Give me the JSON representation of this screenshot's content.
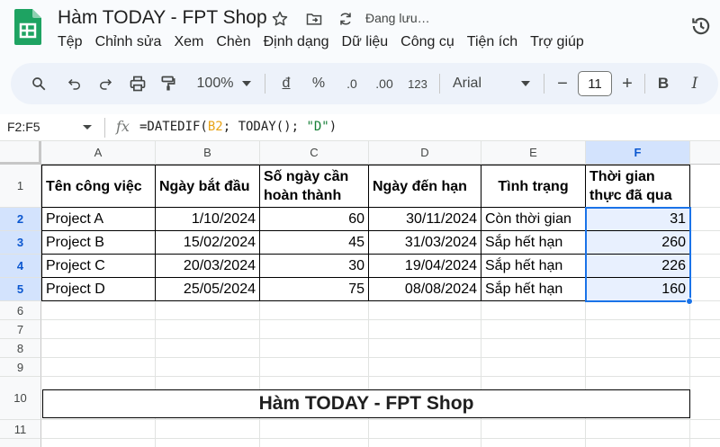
{
  "window": {
    "title": "Hàm TODAY - FPT Shop",
    "save_status": "Đang lưu…"
  },
  "menu": [
    "Tệp",
    "Chỉnh sửa",
    "Xem",
    "Chèn",
    "Định dạng",
    "Dữ liệu",
    "Công cụ",
    "Tiện ích",
    "Trợ giúp"
  ],
  "toolbar": {
    "zoom": "100%",
    "currency": "đ",
    "percent": "%",
    "decrease_decimal": ".0",
    "increase_decimal": ".00",
    "number_format": "123",
    "font": "Arial",
    "font_size": "11",
    "minus": "−",
    "plus": "+",
    "bold": "B",
    "italic": "I"
  },
  "formula_bar": {
    "name_box": "F2:F5",
    "fx": "fx",
    "formula_prefix": "=DATEDIF(",
    "formula_ref": "B2",
    "formula_mid": "; TODAY(); ",
    "formula_str": "\"D\"",
    "formula_suffix": ")"
  },
  "columns": [
    "A",
    "B",
    "C",
    "D",
    "E",
    "F"
  ],
  "rows": [
    "1",
    "2",
    "3",
    "4",
    "5",
    "6",
    "7",
    "8",
    "9",
    "10",
    "11"
  ],
  "table": {
    "headers": [
      "Tên công việc",
      "Ngày bắt đầu",
      "Số ngày cần hoàn thành",
      "Ngày đến hạn",
      "Tình trạng",
      "Thời gian thực đã qua"
    ],
    "data": [
      [
        "Project A",
        "1/10/2024",
        "60",
        "30/11/2024",
        "Còn thời gian",
        "31"
      ],
      [
        "Project B",
        "15/02/2024",
        "45",
        "31/03/2024",
        "Sắp hết hạn",
        "260"
      ],
      [
        "Project C",
        "20/03/2024",
        "30",
        "19/04/2024",
        "Sắp hết hạn",
        "226"
      ],
      [
        "Project D",
        "25/05/2024",
        "75",
        "08/08/2024",
        "Sắp hết hạn",
        "160"
      ]
    ]
  },
  "banner": "Hàm TODAY - FPT Shop",
  "colors": {
    "accent": "#1a73e8",
    "selection": "#d3e3fd",
    "ref": "#e8a317",
    "string": "#188038"
  }
}
